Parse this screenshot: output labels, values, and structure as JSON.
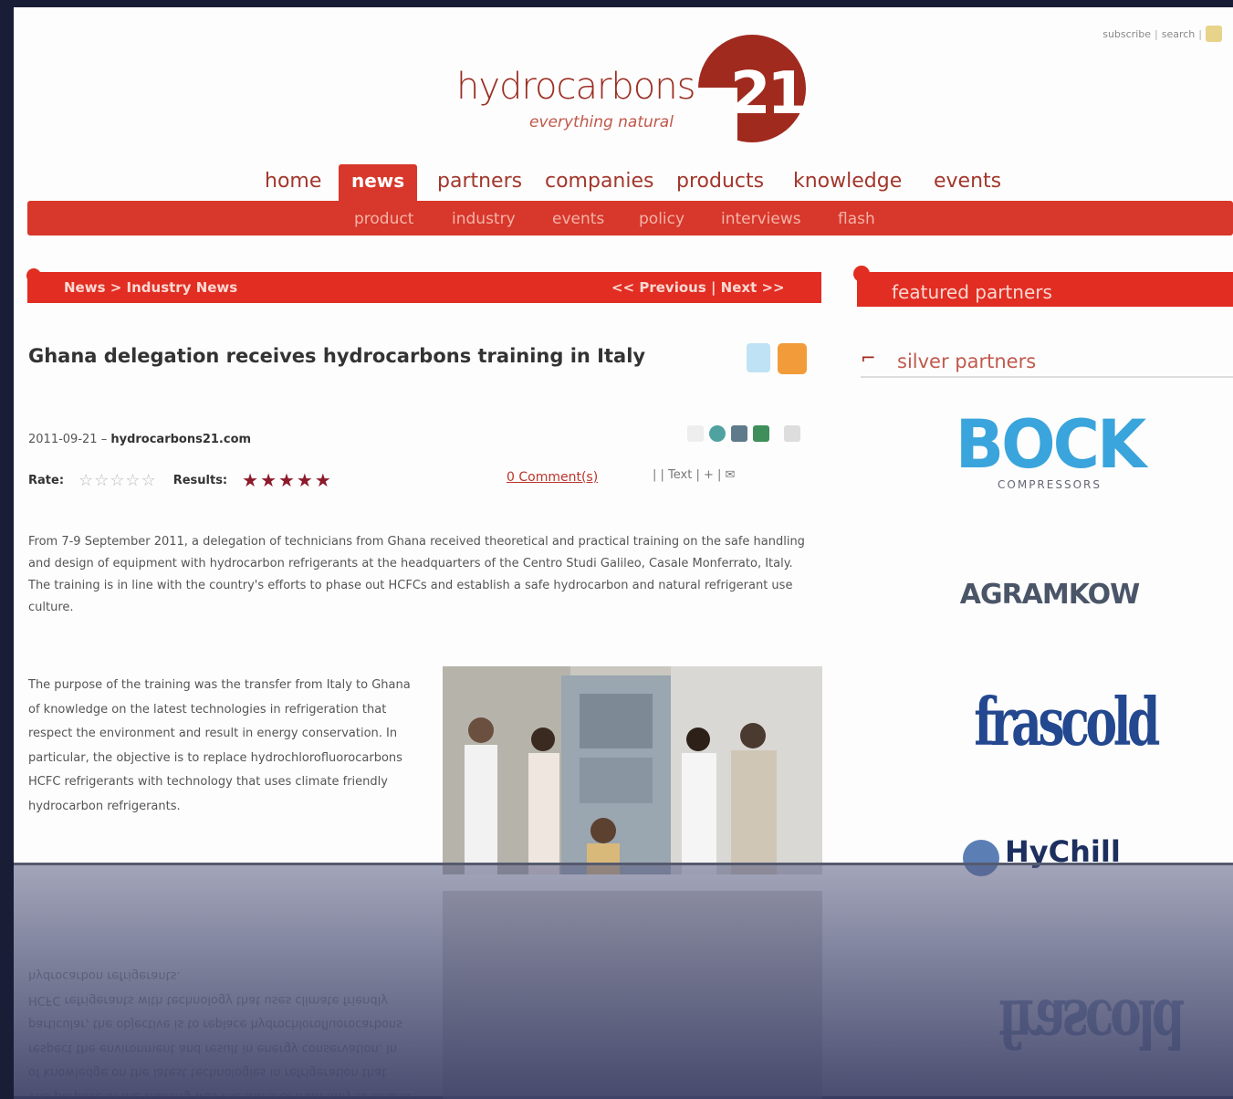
{
  "utility": {
    "subscribe": "subscribe",
    "search": "search",
    "separator": "|"
  },
  "logo": {
    "word": "hydrocarbons",
    "tagline": "everything natural",
    "number": "21"
  },
  "nav": {
    "items": [
      {
        "label": "home"
      },
      {
        "label": "news",
        "active": true
      },
      {
        "label": "partners"
      },
      {
        "label": "companies"
      },
      {
        "label": "products"
      },
      {
        "label": "knowledge"
      },
      {
        "label": "events"
      }
    ],
    "sub": [
      "product",
      "industry",
      "events",
      "policy",
      "interviews",
      "flash"
    ]
  },
  "breadcrumb": {
    "path": "News > Industry News",
    "nav": "<< Previous | Next >>"
  },
  "article": {
    "title": "Ghana delegation receives hydrocarbons training in Italy",
    "date": "2011-09-21",
    "source": "hydrocarbons21.com",
    "rate_label": "Rate:",
    "results_label": "Results:",
    "comments": "0 Comment(s)",
    "font_controls": "| | Text | + | ✉",
    "lead": "From 7-9 September 2011, a delegation of technicians from Ghana received theoretical and practical training on the safe handling and design of equipment with hydrocarbon refrigerants at the headquarters of the Centro Studi Galileo, Casale Monferrato, Italy. The training is in line with the country's efforts to phase out HCFCs and establish a safe hydrocarbon and natural refrigerant use culture.",
    "body": "The purpose of the training was the transfer from Italy to Ghana of knowledge on the latest technologies in refrigeration that respect the environment and result in energy conservation. In particular, the objective is to replace hydrochlorofluorocarbons HCFC refrigerants with technology that uses climate friendly hydrocarbon refrigerants."
  },
  "sidebar": {
    "heading": "featured partners",
    "subheading": "silver partners",
    "partners": [
      {
        "name": "BOCK",
        "sub": "COMPRESSORS"
      },
      {
        "name": "AGRAMKOW"
      },
      {
        "name": "frascold"
      },
      {
        "name": "HyChill"
      }
    ]
  },
  "colors": {
    "brand_red": "#e12d22",
    "logo_red": "#a02a1e",
    "background": "#1a1d36"
  },
  "icons": [
    "twitter-icon",
    "rss-icon",
    "print-icon",
    "email-icon",
    "home-icon"
  ]
}
